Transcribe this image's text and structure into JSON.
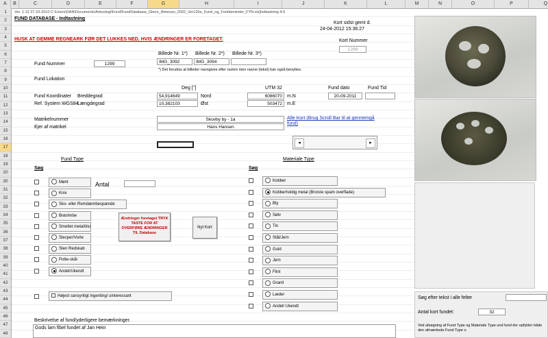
{
  "columns": [
    "A",
    "B",
    "C",
    "D",
    "E",
    "F",
    "G",
    "H",
    "I",
    "J",
    "K",
    "L",
    "M",
    "N",
    "O",
    "P",
    "Q"
  ],
  "selected_column": "G",
  "rows": [
    "1",
    "2",
    "3",
    "4",
    "5",
    "6",
    "7",
    "8",
    "9",
    "10",
    "11",
    "12",
    "13",
    "14",
    "15",
    "16",
    "17",
    "18",
    "19",
    "20",
    "30",
    "31",
    "32",
    "33",
    "34",
    "35",
    "36",
    "37",
    "38",
    "39",
    "40",
    "41",
    "42",
    "43",
    "44",
    "45",
    "46",
    "47",
    "48"
  ],
  "selected_row": "17",
  "header": {
    "version_path": "Ver. 1.12 27-10-2010   C:\\Users\\DAN\\Documents\\Arkeologi\\Fund\\FundDatabase_Glenn_Almesso_2002_Ver120e_Fund_og_Fortidsminder_FYN.xls]Indtastning 4-5",
    "title": "FUND DATABASE - Indtastning",
    "warning": "HUSK AT GEMME REGNEARK FØR DET LUKKES NED, HVIS ÆNDRINGER ER FORETAGET.",
    "card_saved_label": "Kort sidst gemt d.",
    "card_saved_value": "24-04-2012 15:36:27",
    "card_number_label": "Kort Nummer",
    "card_number_value": "1299"
  },
  "images": {
    "label1": "Billede Nr. 1*)",
    "label2": "Billede Nr. 2*)",
    "label3": "Billede Nr. 3*)",
    "value1": "IMG_3092",
    "value2": "IMG_3094",
    "value3": "",
    "note": "*) Det forudsis at billeder navngives efter numre men navne (tekst) kan også benyttes."
  },
  "fund": {
    "number_label": "Fund Nummer",
    "number_value": "1299",
    "location_label": "Fund Lokation",
    "coords_label": "Fund Koordinater",
    "ref_label": "Ref. System WGS84",
    "lat_label": "Breddegrad",
    "lon_label": "Længdegrad",
    "deg_label": "Deg [°]",
    "lat_value": "54,914649",
    "lon_value": "10,382103",
    "north_label": "Nord",
    "east_label": "Øst",
    "utm_label": "UTM 32",
    "utm_n": "6086070",
    "utm_e": "503472",
    "mn_label": "m.N",
    "me_label": "m.E",
    "date_label": "Fund dato",
    "time_label": "Fund Tid",
    "date_value": "20-09-2011",
    "time_value": ""
  },
  "owner": {
    "matrikel_label": "Matrikelnummer",
    "owner_label": "Ejer af matrikel",
    "matrikel_value": "Skovby by - 1a",
    "owner_value": "Hans Hansen",
    "link_text": "Alle Kort (Brug Scroll Bar til at gennemgå fund)"
  },
  "fund_type": {
    "title": "Fund Type",
    "search_label": "Søg",
    "options": [
      "Mønt",
      "Kniv",
      "Sko- eller Remdæmbespænde",
      "Brøshnbe",
      "Smeltet metal/klump",
      "Slecper/Vorte",
      "Sten Redskab",
      "Potte-skår",
      "Andet/Ukendt"
    ],
    "selected_index": 8,
    "quantity_label": "Antal",
    "quantity_value": "",
    "interesting_label": "Højest sansynligt ingenting/ uinteressant"
  },
  "change_notice": "Ændringer foretaget TRYK TASTE FOR AT OVERFØRE ÆNDRINGER TIL Database",
  "new_card_button": "Nyt Kort",
  "material_type": {
    "title": "Materiale Type",
    "search_label": "Søg",
    "options": [
      "Kobber",
      "Kobberholdig metal (Bronze spam overflade)",
      "Bly",
      "Sølv",
      "Tin",
      "Stål/Jern",
      "Guld",
      "Jern",
      "Flint",
      "Granit",
      "Læder",
      "Andet/ Ukendt"
    ],
    "selected_index": 1
  },
  "description": {
    "label": "Beskrivelse af fund/yderligere bemærkninger.",
    "value": "Gods lam fibel fundet af Jan Hein"
  },
  "search_panel": {
    "search_label": "Søg efter tekst i alle felter",
    "search_value": "",
    "count_label": "Antal kort fundet:",
    "count_value": "32",
    "note": "Ved afsøgning af Fund Type og Materiale Type und fund der opfylder både den afmærkede Fund Type o"
  }
}
